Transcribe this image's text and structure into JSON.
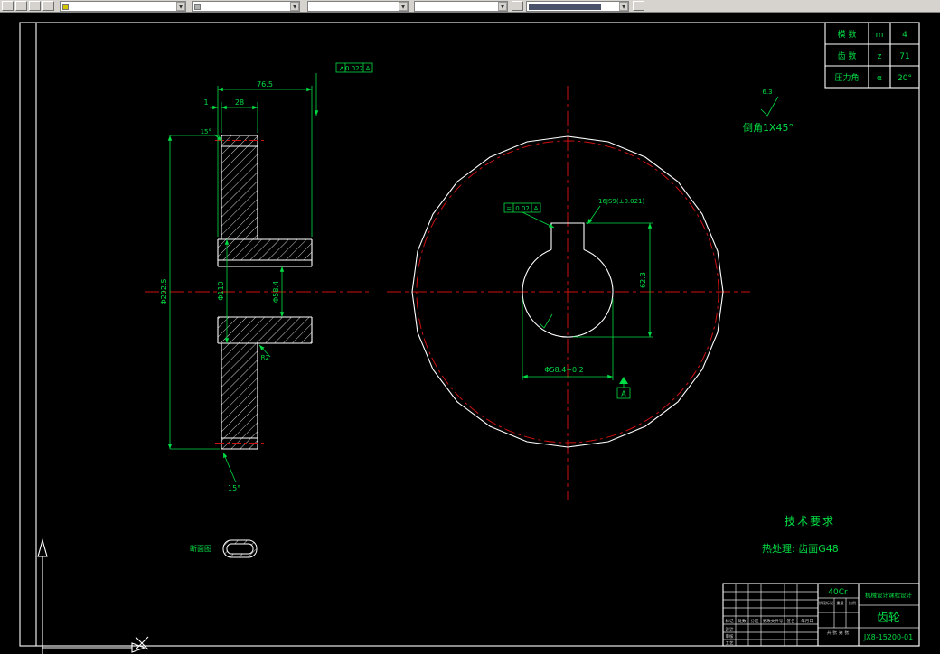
{
  "colors": {
    "background": "#000000",
    "lines": "#ffffff",
    "centerlines": "#cc1111",
    "annotations": "#00dd44"
  },
  "param_table": {
    "rows": [
      {
        "label": "模 数",
        "symbol": "m",
        "value": "4"
      },
      {
        "label": "齿 数",
        "symbol": "z",
        "value": "71"
      },
      {
        "label": "压力角",
        "symbol": "α",
        "value": "20°"
      }
    ]
  },
  "notes": {
    "chamfer_note": "倒角1X45°",
    "roughness_value": "6.3",
    "tech_title": "技术要求",
    "tech_body": "热处理: 齿面G48",
    "section_label": "断面图"
  },
  "dims": {
    "width_total": "76.5",
    "width_rim": "28",
    "width_step": "1",
    "dia_tip": "Φ292.5",
    "dia_hub": "Φ110",
    "dia_bore_side": "Φ58.4",
    "fillet": "R2",
    "chamfer_top": "15°",
    "chamfer_bottom": "15°",
    "keyway_width": "16JS9(±0.021)",
    "keyway_depth": "62.3",
    "dia_bore": "Φ58.4+0.2",
    "datum_label": "A",
    "fcf_face": {
      "sym": "↗",
      "val": "0.022",
      "datum": "A"
    },
    "fcf_key": {
      "sym": "=",
      "val": "0.02",
      "datum": "A"
    }
  },
  "title_block": {
    "material": "40Cr",
    "unit": "机械设计课程设计",
    "part_name": "齿轮",
    "drawing_no": "JX8-15200-01",
    "revision_labels": [
      "标记",
      "处数",
      "分区",
      "更改文件号",
      "签名",
      "年月日"
    ],
    "staff_labels": [
      "设计",
      "审核",
      "工艺"
    ],
    "stage_labels": [
      "阶段标记",
      "重量",
      "比例"
    ],
    "sheet_label": "共 张 第 张"
  }
}
